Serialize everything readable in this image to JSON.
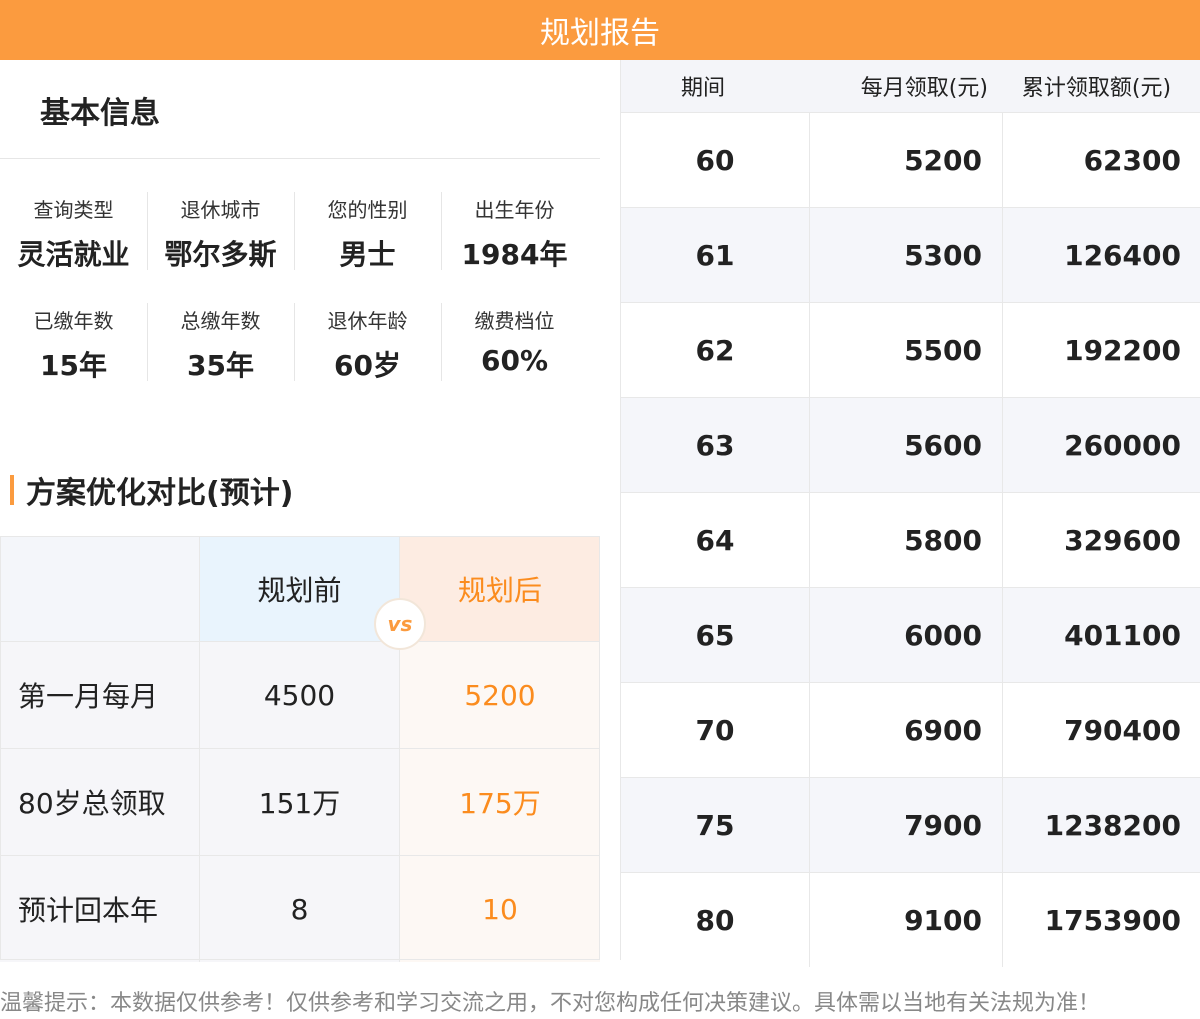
{
  "header": {
    "title": "规划报告"
  },
  "basic_info": {
    "title": "基本信息",
    "rows": [
      [
        {
          "label": "查询类型",
          "value": "灵活就业"
        },
        {
          "label": "退休城市",
          "value": "鄂尔多斯"
        },
        {
          "label": "您的性别",
          "value": "男士"
        },
        {
          "label": "出生年份",
          "value": "1984年"
        }
      ],
      [
        {
          "label": "已缴年数",
          "value": "15年"
        },
        {
          "label": "总缴年数",
          "value": "35年"
        },
        {
          "label": "退休年龄",
          "value": "60岁"
        },
        {
          "label": "缴费档位",
          "value": "60%"
        }
      ]
    ]
  },
  "comparison": {
    "title": "方案优化对比(预计)",
    "before_label": "规划前",
    "after_label": "规划后",
    "vs": "vs",
    "rows": [
      {
        "label": "第一月每月",
        "before": "4500",
        "after": "5200"
      },
      {
        "label": "80岁总领取",
        "before": "151万",
        "after": "175万"
      },
      {
        "label": "预计回本年",
        "before": "8",
        "after": "10"
      }
    ]
  },
  "table": {
    "headers": [
      "期间",
      "每月领取(元)",
      "累计领取额(元)"
    ],
    "rows": [
      [
        "60",
        "5200",
        "62300"
      ],
      [
        "61",
        "5300",
        "126400"
      ],
      [
        "62",
        "5500",
        "192200"
      ],
      [
        "63",
        "5600",
        "260000"
      ],
      [
        "64",
        "5800",
        "329600"
      ],
      [
        "65",
        "6000",
        "401100"
      ],
      [
        "70",
        "6900",
        "790400"
      ],
      [
        "75",
        "7900",
        "1238200"
      ],
      [
        "80",
        "9100",
        "1753900"
      ]
    ]
  },
  "footer": {
    "disclaimer": "温馨提示：本数据仅供参考！仅供参考和学习交流之用，不对您构成任何决策建议。具体需以当地有关法规为准！"
  },
  "colors": {
    "accent": "#fb9b3f",
    "after_text": "#fb8c1e",
    "before_head_bg": "#e9f4fd",
    "after_head_bg": "#fdece2"
  }
}
